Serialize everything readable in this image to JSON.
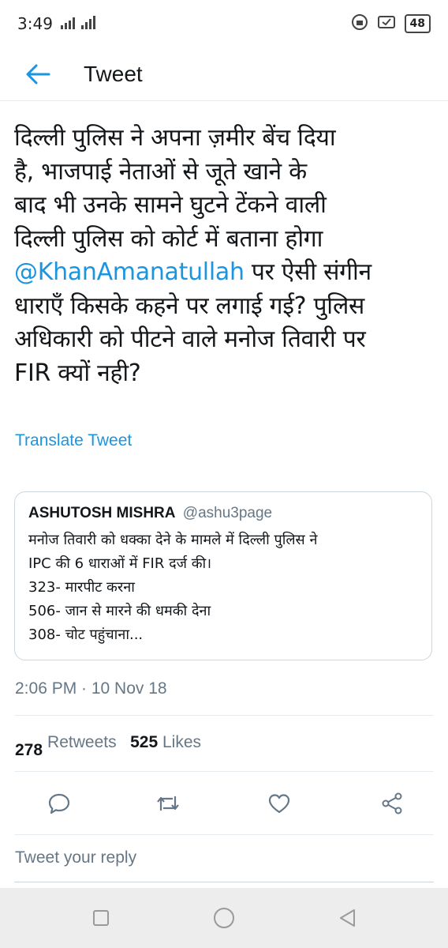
{
  "status_bar": {
    "time": "3:49",
    "network": "4G",
    "battery": "48"
  },
  "header": {
    "title": "Tweet"
  },
  "tweet": {
    "lines": [
      "दिल्ली पुलिस ने अपना ज़मीर बेंच दिया",
      "है, भाजपाई नेताओं से जूते खाने के",
      "बाद भी उनके सामने घुटने टेंकने वाली",
      "दिल्ली पुलिस को कोर्ट में बताना होगा"
    ],
    "mention": "@KhanAmanatullah",
    "mention_rest": " पर ऐसी संगीन",
    "lines_after": [
      "धाराएँ किसके कहने पर लगाई गई? पुलिस",
      "अधिकारी को पीटने वाले मनोज तिवारी पर",
      "FIR क्यों नही?"
    ],
    "translate_label": "Translate Tweet",
    "timestamp": "2:06 PM · 10 Nov 18",
    "retweet_count": "278",
    "retweets_label": "Retweets",
    "likes_count": "525",
    "likes_label": "Likes"
  },
  "quoted_tweet": {
    "name": "ASHUTOSH MISHRA",
    "handle": "@ashu3page",
    "lines": [
      "मनोज तिवारी को धक्का देने के मामले में दिल्ली पुलिस ने",
      "IPC की 6 धाराओं में FIR दर्ज की।",
      "323- मारपीट करना",
      "506- जान से मारने की धमकी देना",
      "308- चोट पहुंचाना..."
    ]
  },
  "actions": [
    "reply-icon",
    "retweet-icon",
    "like-icon",
    "share-icon"
  ],
  "reply": {
    "placeholder": "Tweet your reply"
  },
  "colors": {
    "accent": "#1b95e0",
    "secondary_text": "#657786",
    "divider": "#e6ecf0"
  }
}
